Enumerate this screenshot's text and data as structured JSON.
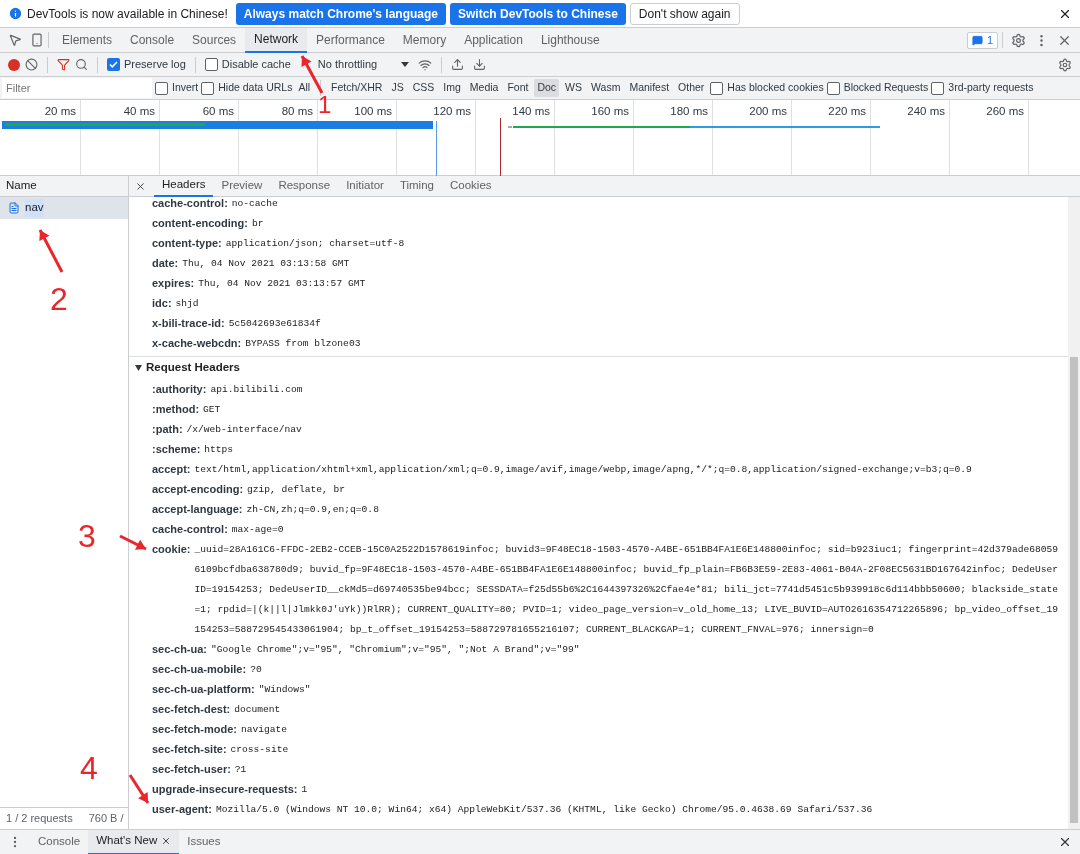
{
  "infobar": {
    "message": "DevTools is now available in Chinese!",
    "buttons": [
      {
        "label": "Always match Chrome's language",
        "kind": "primary"
      },
      {
        "label": "Switch DevTools to Chinese",
        "kind": "primary"
      },
      {
        "label": "Don't show again",
        "kind": "plain"
      }
    ]
  },
  "panel_tabs": [
    {
      "label": "Elements",
      "selected": false
    },
    {
      "label": "Console",
      "selected": false
    },
    {
      "label": "Sources",
      "selected": false
    },
    {
      "label": "Network",
      "selected": true
    },
    {
      "label": "Performance",
      "selected": false
    },
    {
      "label": "Memory",
      "selected": false
    },
    {
      "label": "Application",
      "selected": false
    },
    {
      "label": "Lighthouse",
      "selected": false
    }
  ],
  "issues_badge": "1",
  "toolbar": {
    "recording": true,
    "preserve_log": {
      "label": "Preserve log",
      "checked": true
    },
    "disable_cache": {
      "label": "Disable cache",
      "checked": false
    },
    "throttling": "No throttling"
  },
  "filter_bar": {
    "placeholder": "Filter",
    "invert": {
      "label": "Invert",
      "checked": false
    },
    "hide_data_urls": {
      "label": "Hide data URLs",
      "checked": false
    },
    "types": [
      {
        "label": "All",
        "selected": false
      },
      {
        "label": "Fetch/XHR",
        "selected": false
      },
      {
        "label": "JS",
        "selected": false
      },
      {
        "label": "CSS",
        "selected": false
      },
      {
        "label": "Img",
        "selected": false
      },
      {
        "label": "Media",
        "selected": false
      },
      {
        "label": "Font",
        "selected": false
      },
      {
        "label": "Doc",
        "selected": true
      },
      {
        "label": "WS",
        "selected": false
      },
      {
        "label": "Wasm",
        "selected": false
      },
      {
        "label": "Manifest",
        "selected": false
      },
      {
        "label": "Other",
        "selected": false
      }
    ],
    "options": [
      {
        "label": "Has blocked cookies",
        "checked": false
      },
      {
        "label": "Blocked Requests",
        "checked": false
      },
      {
        "label": "3rd-party requests",
        "checked": false
      }
    ]
  },
  "timeline": {
    "ticks": [
      "20 ms",
      "40 ms",
      "60 ms",
      "80 ms",
      "100 ms",
      "120 ms",
      "140 ms",
      "160 ms",
      "180 ms",
      "200 ms",
      "220 ms",
      "240 ms",
      "260 ms"
    ]
  },
  "requests": {
    "column": "Name",
    "rows": [
      {
        "name": "nav",
        "selected": true
      }
    ],
    "status": [
      "1 / 2 requests",
      "760 B /"
    ]
  },
  "detail_tabs": [
    {
      "label": "Headers",
      "selected": true
    },
    {
      "label": "Preview",
      "selected": false
    },
    {
      "label": "Response",
      "selected": false
    },
    {
      "label": "Initiator",
      "selected": false
    },
    {
      "label": "Timing",
      "selected": false
    },
    {
      "label": "Cookies",
      "selected": false
    }
  ],
  "response_headers": [
    {
      "name": "cache-control:",
      "value": "no-cache"
    },
    {
      "name": "content-encoding:",
      "value": "br"
    },
    {
      "name": "content-type:",
      "value": "application/json; charset=utf-8"
    },
    {
      "name": "date:",
      "value": "Thu, 04 Nov 2021 03:13:58 GMT"
    },
    {
      "name": "expires:",
      "value": "Thu, 04 Nov 2021 03:13:57 GMT"
    },
    {
      "name": "idc:",
      "value": "shjd"
    },
    {
      "name": "x-bili-trace-id:",
      "value": "5c5042693e61834f"
    },
    {
      "name": "x-cache-webcdn:",
      "value": "BYPASS from blzone03"
    }
  ],
  "request_headers": {
    "title": "Request Headers",
    "expanded": true,
    "rows": [
      {
        "name": ":authority:",
        "value": "api.bilibili.com"
      },
      {
        "name": ":method:",
        "value": "GET"
      },
      {
        "name": ":path:",
        "value": "/x/web-interface/nav"
      },
      {
        "name": ":scheme:",
        "value": "https"
      },
      {
        "name": "accept:",
        "value": "text/html,application/xhtml+xml,application/xml;q=0.9,image/avif,image/webp,image/apng,*/*;q=0.8,application/signed-exchange;v=b3;q=0.9"
      },
      {
        "name": "accept-encoding:",
        "value": "gzip, deflate, br"
      },
      {
        "name": "accept-language:",
        "value": "zh-CN,zh;q=0.9,en;q=0.8"
      },
      {
        "name": "cache-control:",
        "value": "max-age=0"
      },
      {
        "name": "cookie:",
        "value": "_uuid=28A161C6-FFDC-2EB2-CCEB-15C0A2522D1578619infoc; buvid3=9F48EC18-1503-4570-A4BE-651BB4FA1E6E148800infoc; sid=b923iuc1; fingerprint=42d379ade680596109bcfdba638780d9; buvid_fp=9F48EC18-1503-4570-A4BE-651BB4FA1E6E148800infoc; buvid_fp_plain=FB6B3E59-2E83-4061-B04A-2F08EC5631BD167642infoc; DedeUserID=19154253; DedeUserID__ckMd5=d69740535be94bcc; SESSDATA=f25d55b6%2C1644397326%2Cfae4e*81; bili_jct=7741d5451c5b939918c6d114bbb50600; blackside_state=1; rpdid=|(k||l|Jlmkk0J'uYk))RlRR); CURRENT_QUALITY=80; PVID=1; video_page_version=v_old_home_13; LIVE_BUVID=AUTO2616354712265896; bp_video_offset_19154253=588729545433061904; bp_t_offset_19154253=588729781655216107; CURRENT_BLACKGAP=1; CURRENT_FNVAL=976; innersign=0"
      },
      {
        "name": "sec-ch-ua:",
        "value": "\"Google Chrome\";v=\"95\", \"Chromium\";v=\"95\", \";Not A Brand\";v=\"99\""
      },
      {
        "name": "sec-ch-ua-mobile:",
        "value": "?0"
      },
      {
        "name": "sec-ch-ua-platform:",
        "value": "\"Windows\""
      },
      {
        "name": "sec-fetch-dest:",
        "value": "document"
      },
      {
        "name": "sec-fetch-mode:",
        "value": "navigate"
      },
      {
        "name": "sec-fetch-site:",
        "value": "cross-site"
      },
      {
        "name": "sec-fetch-user:",
        "value": "?1"
      },
      {
        "name": "upgrade-insecure-requests:",
        "value": "1"
      },
      {
        "name": "user-agent:",
        "value": "Mozilla/5.0 (Windows NT 10.0; Win64; x64) AppleWebKit/537.36 (KHTML, like Gecko) Chrome/95.0.4638.69 Safari/537.36"
      }
    ]
  },
  "drawer_tabs": [
    {
      "label": "Console",
      "selected": false
    },
    {
      "label": "What's New",
      "selected": true
    },
    {
      "label": "Issues",
      "selected": false
    }
  ],
  "annotations": [
    {
      "label": "1"
    },
    {
      "label": "2"
    },
    {
      "label": "3"
    },
    {
      "label": "4"
    }
  ]
}
